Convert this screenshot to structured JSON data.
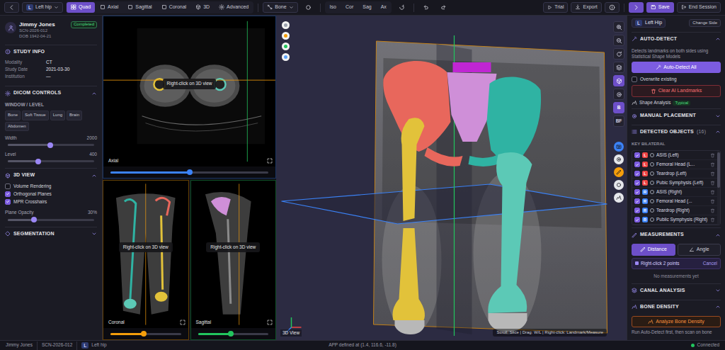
{
  "topbar": {
    "side_badge": "L",
    "side": "Left hip",
    "tabs": [
      {
        "label": "Quad",
        "selected": true
      },
      {
        "label": "Axial",
        "selected": false
      },
      {
        "label": "Sagittal",
        "selected": false
      },
      {
        "label": "Coronal",
        "selected": false
      },
      {
        "label": "3D",
        "selected": false
      },
      {
        "label": "Advanced",
        "selected": false
      }
    ],
    "preset": "Bone",
    "orientations": [
      "Iso",
      "Cor",
      "Sag",
      "Ax"
    ],
    "trial": "Trial",
    "export": "Export",
    "save": "Save",
    "end": "End Session"
  },
  "patient": {
    "name": "Jimmy Jones",
    "id": "SCN-2026-012",
    "dob": "DOB 1942-04-21",
    "status": "Completed"
  },
  "study": {
    "title": "STUDY INFO",
    "rows": [
      {
        "label": "Modality",
        "value": "CT"
      },
      {
        "label": "Study Date",
        "value": "2021-03-30"
      },
      {
        "label": "Institution",
        "value": "—"
      }
    ]
  },
  "dicom": {
    "title": "DICOM CONTROLS",
    "expanded": true
  },
  "window_level": {
    "title": "WINDOW / LEVEL",
    "presets": [
      "Bone",
      "Soft Tissue",
      "Lung",
      "Brain",
      "Abdomen"
    ],
    "sliders": [
      {
        "label": "Width",
        "reading": "2000",
        "level": 0.49
      },
      {
        "label": "Level",
        "reading": "400",
        "level": 0.35
      }
    ]
  },
  "view3d": {
    "title": "3D VIEW",
    "expanded": true,
    "options": [
      {
        "label": "Volume Rendering",
        "checked": false
      },
      {
        "label": "Orthogonal Planes",
        "checked": true
      },
      {
        "label": "MPR Crosshairs",
        "checked": true
      }
    ],
    "opacity": {
      "label": "Plane Opacity",
      "reading": "30%",
      "level": 0.3
    }
  },
  "segmentation": {
    "title": "SEGMENTATION",
    "expanded": false
  },
  "views": [
    {
      "label": "Axial",
      "hint": "Right-click on 3D view",
      "level": 0.5,
      "color": "#3b82f6"
    },
    {
      "label": "Coronal",
      "hint": "Right-click on 3D view",
      "level": 0.47,
      "color": "#f59e0b"
    },
    {
      "label": "Sagittal",
      "hint": "Right-click on 3D view",
      "level": 0.47,
      "color": "#22c55e"
    }
  ],
  "scene": {
    "label": "3D View",
    "hint": "Scroll: Slice | Drag: W/L | Right-click: Landmark/Measure",
    "segments": [
      {
        "color": "#e8675c"
      },
      {
        "color": "#cf8fd8"
      },
      {
        "color": "#c026d3"
      },
      {
        "color": "#2fb3a3"
      },
      {
        "color": "#e2c23a"
      },
      {
        "color": "#5cc9b6"
      },
      {
        "color": "#b8b8b8"
      }
    ],
    "orient": [
      {
        "color": "#9ca3af"
      },
      {
        "color": "#f59e0b"
      },
      {
        "color": "#22c55e"
      },
      {
        "color": "#60a5fa"
      }
    ],
    "tools": [
      {
        "selected": false
      },
      {
        "selected": false
      },
      {
        "selected": false
      },
      {
        "selected": false
      },
      {
        "selected": true
      },
      {
        "selected": false
      }
    ],
    "labels": [
      {
        "label": "B",
        "selected": true
      },
      {
        "label": "BF",
        "selected": false
      }
    ],
    "quick": [
      {
        "color": "#3b82f6"
      },
      {
        "color": "#e5e7eb"
      },
      {
        "color": "#f59e0b"
      },
      {
        "color": "#e5e7eb"
      },
      {
        "color": "#e5e7eb"
      }
    ]
  },
  "right": {
    "side_badge": "L",
    "side": "Left Hip",
    "change": "Change Side",
    "auto": {
      "title": "AUTO-DETECT",
      "expanded": true,
      "desc": "Detects landmarks on both sides using Statistical Shape Models",
      "button": "Auto-Detect All",
      "overwrite": {
        "label": "Overwrite existing",
        "checked": false
      },
      "clear": "Clear AI Landmarks",
      "shape": "Shape Analysis",
      "shape_badge": "Typical"
    },
    "manual": {
      "title": "MANUAL PLACEMENT",
      "expanded": false
    },
    "detected": {
      "title": "DETECTED OBJECTS",
      "count": "(16)",
      "expanded": true,
      "group": "KEY BILATERAL",
      "items": [
        {
          "badge": "L",
          "label": "ASIS (Left)",
          "checked": true,
          "color": "#ef4444"
        },
        {
          "badge": "L",
          "label": "Femoral Head (L...",
          "checked": true,
          "color": "#ef4444"
        },
        {
          "badge": "L",
          "label": "Teardrop (Left)",
          "checked": true,
          "color": "#ef4444"
        },
        {
          "badge": "L",
          "label": "Pubic Symphysis (Left)",
          "checked": true,
          "color": "#ef4444"
        },
        {
          "badge": "R",
          "label": "ASIS (Right)",
          "checked": true,
          "color": "#3b82f6"
        },
        {
          "badge": "R",
          "label": "Femoral Head (...",
          "checked": true,
          "color": "#3b82f6"
        },
        {
          "badge": "R",
          "label": "Teardrop (Right)",
          "checked": true,
          "color": "#3b82f6"
        },
        {
          "badge": "R",
          "label": "Public Symphysis (Right)",
          "checked": true,
          "color": "#3b82f6"
        }
      ]
    },
    "measure": {
      "title": "MEASUREMENTS",
      "expanded": true,
      "modes": [
        {
          "label": "Distance",
          "selected": true
        },
        {
          "label": "Angle",
          "selected": false
        }
      ],
      "prompt": "Right-click 2 points",
      "cancel": "Cancel",
      "empty": "No measurements yet"
    },
    "canal": {
      "title": "CANAL ANALYSIS",
      "expanded": false
    },
    "density": {
      "title": "BONE DENSITY",
      "expanded": true,
      "button": "Analyze Bone Density",
      "note": "Run Auto-Detect first, then scan on bone"
    }
  },
  "status_bar": {
    "name": "Jimmy Jones",
    "id": "SCN-2026-012",
    "side_badge": "L",
    "side": "Left hip",
    "message": "APP defined at (1.4, 116.6, -11.8)",
    "connection": "Connected",
    "connected": true
  }
}
